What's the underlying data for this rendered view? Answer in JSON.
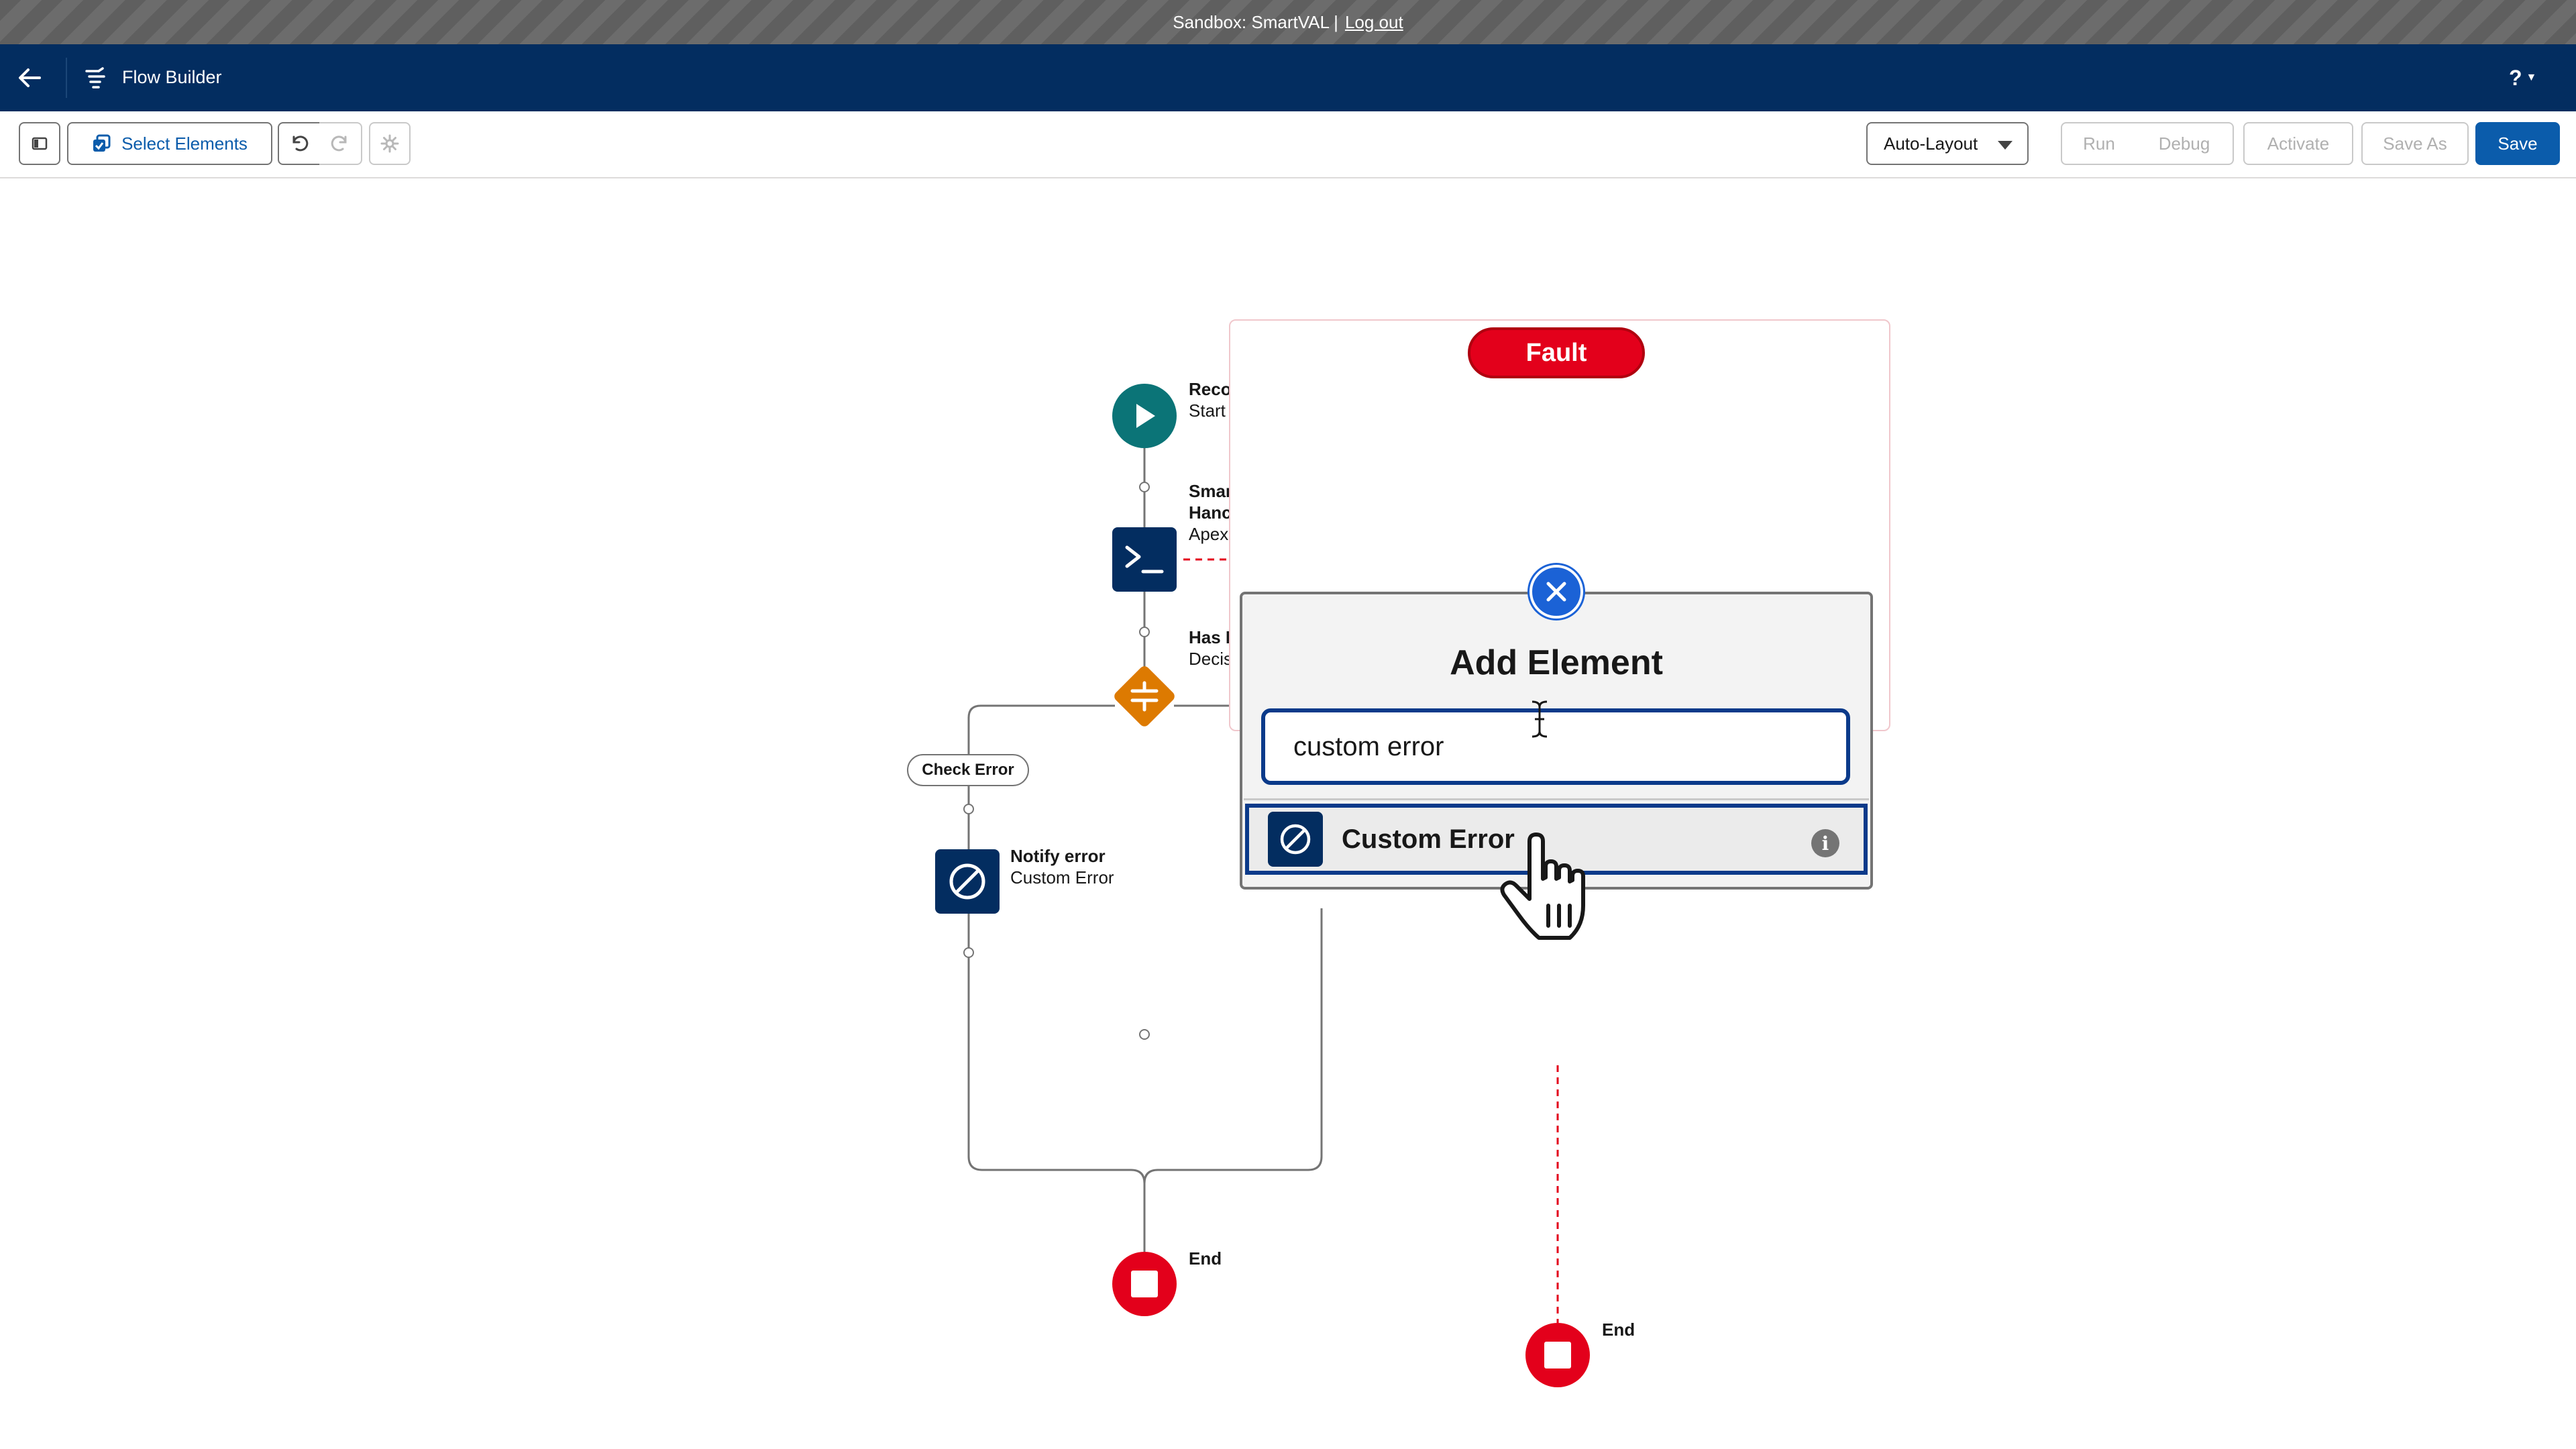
{
  "sandbox": {
    "label": "Sandbox: SmartVAL |",
    "logout": "Log out"
  },
  "header": {
    "app_title": "Flow Builder",
    "help": "?"
  },
  "toolbar": {
    "select_elements": "Select Elements",
    "layout_mode": "Auto-Layout",
    "run": "Run",
    "debug": "Debug",
    "activate": "Activate",
    "save_as": "Save As",
    "save": "Save"
  },
  "flow": {
    "start": {
      "title": "Record-Triggered Flow",
      "subtitle": "Start"
    },
    "apex": {
      "title_line1": "Smarteeva Business Rule",
      "title_line2": "Hanc",
      "subtitle": "Apex"
    },
    "decision": {
      "title": "Has I",
      "subtitle": "Decis"
    },
    "check_error": "Check Error",
    "notify": {
      "title": "Notify error",
      "subtitle": "Custom Error"
    },
    "end_main": "End",
    "end_fault": "End"
  },
  "popover": {
    "fault_badge": "Fault",
    "title": "Add Element",
    "search_value": "custom error",
    "result_label": "Custom Error",
    "info": "i"
  },
  "colors": {
    "header_bg": "#032d60",
    "accent_blue": "#0b5cab",
    "start_teal": "#0b7477",
    "decision_orange": "#dd7a01",
    "end_red": "#e3001b"
  },
  "icons": {
    "back": "arrow-left-icon",
    "app": "flow-icon",
    "start": "play-icon",
    "apex": "terminal-icon",
    "decision": "decision-icon",
    "custom_error": "block-icon",
    "end": "stop-icon",
    "close": "close-icon",
    "info": "info-icon"
  }
}
